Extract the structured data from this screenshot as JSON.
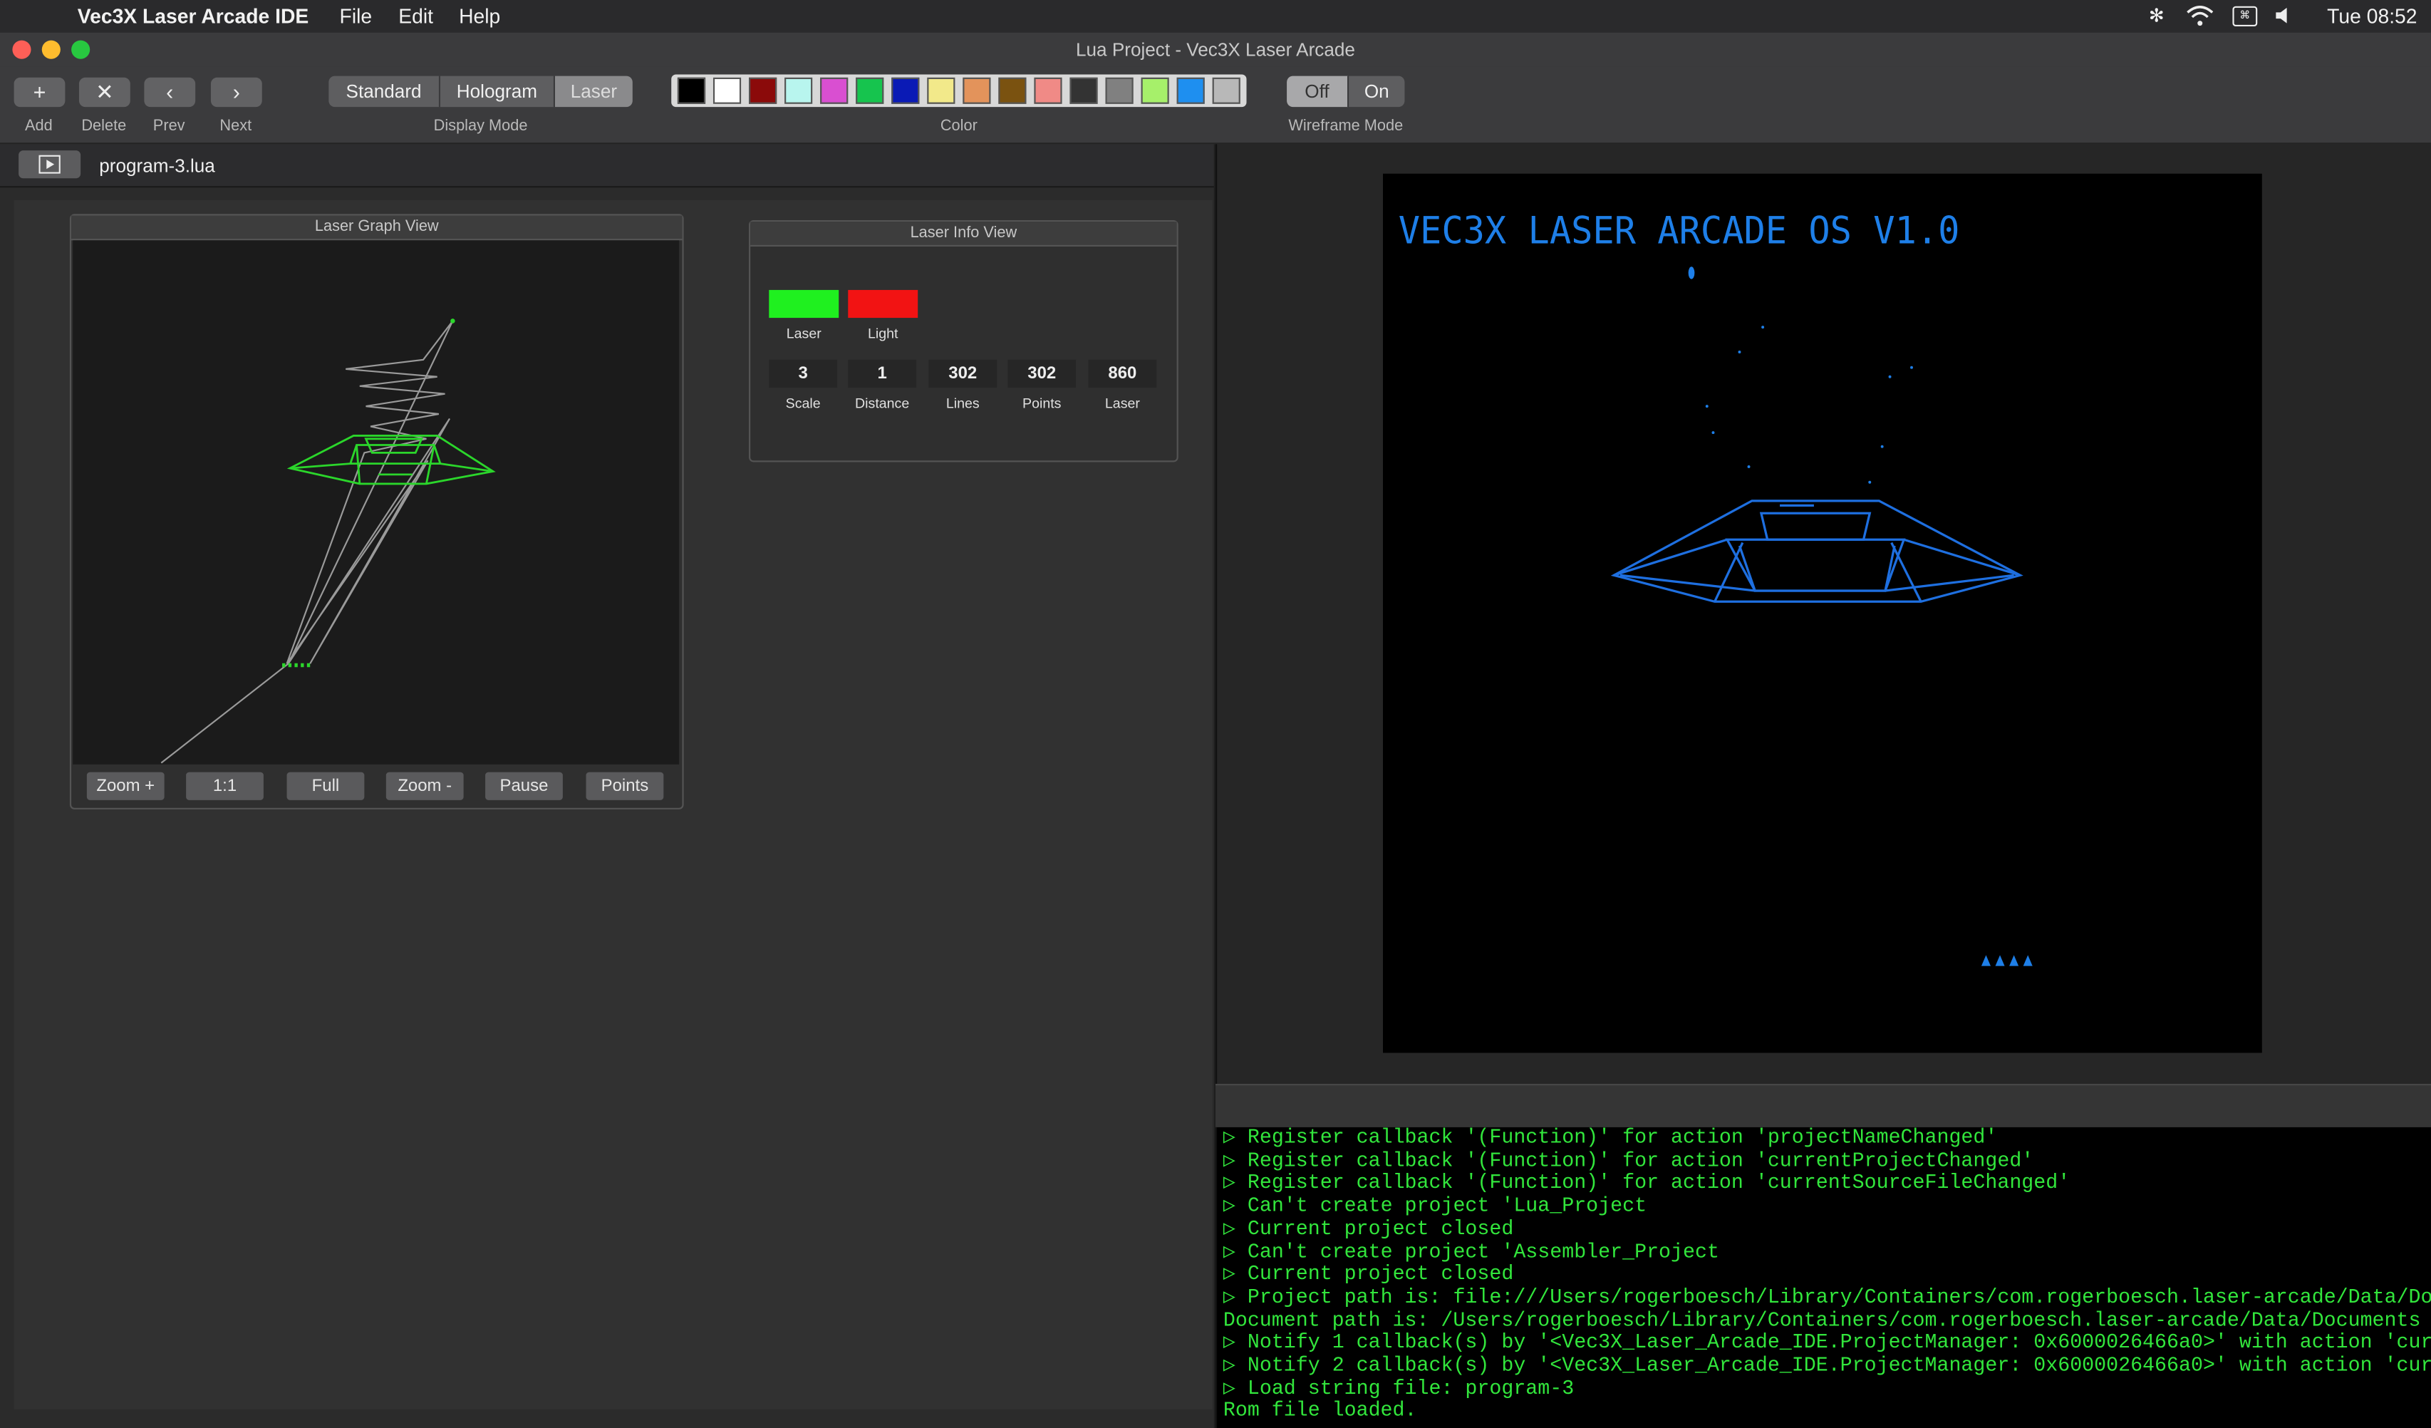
{
  "menubar": {
    "app_name": "Vec3X Laser Arcade IDE",
    "menus": [
      "File",
      "Edit",
      "Help"
    ],
    "clock": "Tue 08:52"
  },
  "window": {
    "title": "Lua Project - Vec3X Laser Arcade"
  },
  "toolbar": {
    "add_label": "Add",
    "delete_label": "Delete",
    "prev_label": "Prev",
    "next_label": "Next",
    "display_mode_label": "Display Mode",
    "display_modes": [
      "Standard",
      "Hologram",
      "Laser"
    ],
    "display_mode_selected": "Laser",
    "color_label": "Color",
    "colors": [
      "#000000",
      "#ffffff",
      "#8b0a0a",
      "#b8f5ee",
      "#d94fd1",
      "#16c44e",
      "#0a1ab5",
      "#f2e98a",
      "#e3935b",
      "#7a5210",
      "#f08a86",
      "#333333",
      "#808080",
      "#a6f06a",
      "#1e8ff0",
      "#b8b8b8"
    ],
    "wireframe_label": "Wireframe Mode",
    "wireframe_options": [
      "Off",
      "On"
    ],
    "wireframe_selected": "Off"
  },
  "tab": {
    "filename": "program-3.lua"
  },
  "graph_view": {
    "title": "Laser Graph View",
    "buttons": [
      "Zoom +",
      "1:1",
      "Full",
      "Zoom -",
      "Pause",
      "Points"
    ]
  },
  "info_view": {
    "title": "Laser Info View",
    "laser_label": "Laser",
    "light_label": "Light",
    "laser_color": "#1ff01f",
    "light_color": "#f21313",
    "stats": [
      {
        "value": "3",
        "label": "Scale"
      },
      {
        "value": "1",
        "label": "Distance"
      },
      {
        "value": "302",
        "label": "Lines"
      },
      {
        "value": "302",
        "label": "Points"
      },
      {
        "value": "860",
        "label": "Laser"
      }
    ]
  },
  "screen": {
    "title": "VEC3X LASER ARCADE OS V1.0"
  },
  "console": {
    "lines": [
      "▷ Register callback '(Function)' for action 'projectNameChanged'",
      "▷ Register callback '(Function)' for action 'currentProjectChanged'",
      "▷ Register callback '(Function)' for action 'currentSourceFileChanged'",
      "▷ Can't create project 'Lua_Project",
      "▷ Current project closed",
      "▷ Can't create project 'Assembler_Project",
      "▷ Current project closed",
      "▷ Project path is: file:///Users/rogerboesch/Library/Containers/com.rogerboesch.laser-arcade/Data/Doc",
      "Document path is: /Users/rogerboesch/Library/Containers/com.rogerboesch.laser-arcade/Data/Documents",
      "▷ Notify 1 callback(s) by '<Vec3X_Laser_Arcade_IDE.ProjectManager: 0x6000026466a0>' with action 'curr",
      "▷ Notify 2 callback(s) by '<Vec3X_Laser_Arcade_IDE.ProjectManager: 0x6000026466a0>' with action 'curr",
      "▷ Load string file: program-3",
      "Rom file loaded."
    ]
  }
}
